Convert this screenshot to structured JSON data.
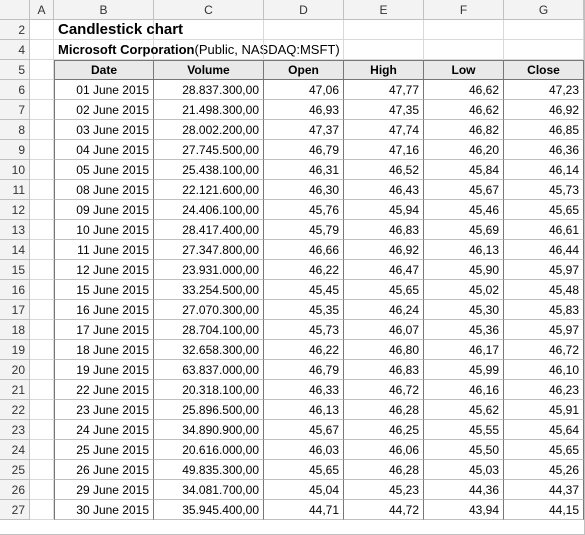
{
  "columns": [
    "A",
    "B",
    "C",
    "D",
    "E",
    "F",
    "G"
  ],
  "row_numbers": [
    2,
    4,
    5,
    6,
    7,
    8,
    9,
    10,
    11,
    12,
    13,
    14,
    15,
    16,
    17,
    18,
    19,
    20,
    21,
    22,
    23,
    24,
    25,
    26,
    27
  ],
  "title": "Candlestick chart",
  "subtitle_bold": "Microsoft Corporation",
  "subtitle_plain": " (Public, NASDAQ:MSFT)",
  "headers": [
    "Date",
    "Volume",
    "Open",
    "High",
    "Low",
    "Close"
  ],
  "rows": [
    {
      "date": "01 June 2015",
      "volume": "28.837.300,00",
      "open": "47,06",
      "high": "47,77",
      "low": "46,62",
      "close": "47,23"
    },
    {
      "date": "02 June 2015",
      "volume": "21.498.300,00",
      "open": "46,93",
      "high": "47,35",
      "low": "46,62",
      "close": "46,92"
    },
    {
      "date": "03 June 2015",
      "volume": "28.002.200,00",
      "open": "47,37",
      "high": "47,74",
      "low": "46,82",
      "close": "46,85"
    },
    {
      "date": "04 June 2015",
      "volume": "27.745.500,00",
      "open": "46,79",
      "high": "47,16",
      "low": "46,20",
      "close": "46,36"
    },
    {
      "date": "05 June 2015",
      "volume": "25.438.100,00",
      "open": "46,31",
      "high": "46,52",
      "low": "45,84",
      "close": "46,14"
    },
    {
      "date": "08 June 2015",
      "volume": "22.121.600,00",
      "open": "46,30",
      "high": "46,43",
      "low": "45,67",
      "close": "45,73"
    },
    {
      "date": "09 June 2015",
      "volume": "24.406.100,00",
      "open": "45,76",
      "high": "45,94",
      "low": "45,46",
      "close": "45,65"
    },
    {
      "date": "10 June 2015",
      "volume": "28.417.400,00",
      "open": "45,79",
      "high": "46,83",
      "low": "45,69",
      "close": "46,61"
    },
    {
      "date": "11 June 2015",
      "volume": "27.347.800,00",
      "open": "46,66",
      "high": "46,92",
      "low": "46,13",
      "close": "46,44"
    },
    {
      "date": "12 June 2015",
      "volume": "23.931.000,00",
      "open": "46,22",
      "high": "46,47",
      "low": "45,90",
      "close": "45,97"
    },
    {
      "date": "15 June 2015",
      "volume": "33.254.500,00",
      "open": "45,45",
      "high": "45,65",
      "low": "45,02",
      "close": "45,48"
    },
    {
      "date": "16 June 2015",
      "volume": "27.070.300,00",
      "open": "45,35",
      "high": "46,24",
      "low": "45,30",
      "close": "45,83"
    },
    {
      "date": "17 June 2015",
      "volume": "28.704.100,00",
      "open": "45,73",
      "high": "46,07",
      "low": "45,36",
      "close": "45,97"
    },
    {
      "date": "18 June 2015",
      "volume": "32.658.300,00",
      "open": "46,22",
      "high": "46,80",
      "low": "46,17",
      "close": "46,72"
    },
    {
      "date": "19 June 2015",
      "volume": "63.837.000,00",
      "open": "46,79",
      "high": "46,83",
      "low": "45,99",
      "close": "46,10"
    },
    {
      "date": "22 June 2015",
      "volume": "20.318.100,00",
      "open": "46,33",
      "high": "46,72",
      "low": "46,16",
      "close": "46,23"
    },
    {
      "date": "23 June 2015",
      "volume": "25.896.500,00",
      "open": "46,13",
      "high": "46,28",
      "low": "45,62",
      "close": "45,91"
    },
    {
      "date": "24 June 2015",
      "volume": "34.890.900,00",
      "open": "45,67",
      "high": "46,25",
      "low": "45,55",
      "close": "45,64"
    },
    {
      "date": "25 June 2015",
      "volume": "20.616.000,00",
      "open": "46,03",
      "high": "46,06",
      "low": "45,50",
      "close": "45,65"
    },
    {
      "date": "26 June 2015",
      "volume": "49.835.300,00",
      "open": "45,65",
      "high": "46,28",
      "low": "45,03",
      "close": "45,26"
    },
    {
      "date": "29 June 2015",
      "volume": "34.081.700,00",
      "open": "45,04",
      "high": "45,23",
      "low": "44,36",
      "close": "44,37"
    },
    {
      "date": "30 June 2015",
      "volume": "35.945.400,00",
      "open": "44,71",
      "high": "44,72",
      "low": "43,94",
      "close": "44,15"
    }
  ],
  "chart_data": {
    "type": "table",
    "title": "Candlestick chart — Microsoft Corporation (Public, NASDAQ:MSFT)",
    "columns": [
      "Date",
      "Volume",
      "Open",
      "High",
      "Low",
      "Close"
    ],
    "x": [
      "01 June 2015",
      "02 June 2015",
      "03 June 2015",
      "04 June 2015",
      "05 June 2015",
      "08 June 2015",
      "09 June 2015",
      "10 June 2015",
      "11 June 2015",
      "12 June 2015",
      "15 June 2015",
      "16 June 2015",
      "17 June 2015",
      "18 June 2015",
      "19 June 2015",
      "22 June 2015",
      "23 June 2015",
      "24 June 2015",
      "25 June 2015",
      "26 June 2015",
      "29 June 2015",
      "30 June 2015"
    ],
    "series": [
      {
        "name": "Volume",
        "values": [
          28837300,
          21498300,
          28002200,
          27745500,
          25438100,
          22121600,
          24406100,
          28417400,
          27347800,
          23931000,
          33254500,
          27070300,
          28704100,
          32658300,
          63837000,
          20318100,
          25896500,
          34890900,
          20616000,
          49835300,
          34081700,
          35945400
        ]
      },
      {
        "name": "Open",
        "values": [
          47.06,
          46.93,
          47.37,
          46.79,
          46.31,
          46.3,
          45.76,
          45.79,
          46.66,
          46.22,
          45.45,
          45.35,
          45.73,
          46.22,
          46.79,
          46.33,
          46.13,
          45.67,
          46.03,
          45.65,
          45.04,
          44.71
        ]
      },
      {
        "name": "High",
        "values": [
          47.77,
          47.35,
          47.74,
          47.16,
          46.52,
          46.43,
          45.94,
          46.83,
          46.92,
          46.47,
          45.65,
          46.24,
          46.07,
          46.8,
          46.83,
          46.72,
          46.28,
          46.25,
          46.06,
          46.28,
          45.23,
          44.72
        ]
      },
      {
        "name": "Low",
        "values": [
          46.62,
          46.62,
          46.82,
          46.2,
          45.84,
          45.67,
          45.46,
          45.69,
          46.13,
          45.9,
          45.02,
          45.3,
          45.36,
          46.17,
          45.99,
          46.16,
          45.62,
          45.55,
          45.5,
          45.03,
          44.36,
          43.94
        ]
      },
      {
        "name": "Close",
        "values": [
          47.23,
          46.92,
          46.85,
          46.36,
          46.14,
          45.73,
          45.65,
          46.61,
          46.44,
          45.97,
          45.48,
          45.83,
          45.97,
          46.72,
          46.1,
          46.23,
          45.91,
          45.64,
          45.65,
          45.26,
          44.37,
          44.15
        ]
      }
    ]
  }
}
